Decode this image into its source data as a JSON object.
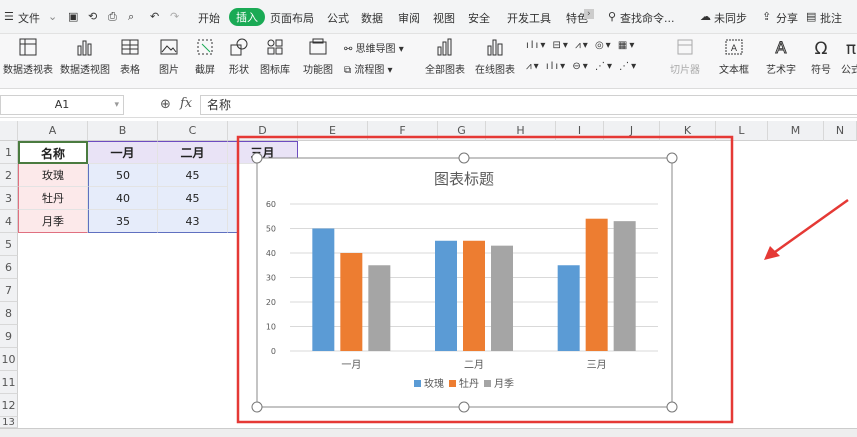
{
  "menubar": {
    "file": "文件",
    "items": [
      "开始",
      "插入",
      "页面布局",
      "公式",
      "数据",
      "审阅",
      "视图",
      "安全",
      "开发工具",
      "特色"
    ],
    "active": "插入",
    "search": "查找命令...",
    "unsync": "未同步",
    "share": "分享",
    "comment": "批注"
  },
  "ribbon": {
    "pivot_table": "数据透视表",
    "pivot_chart": "数据透视图",
    "table": "表格",
    "picture": "图片",
    "screenshot": "截屏",
    "shape": "形状",
    "icon_lib": "图标库",
    "func_chart": "功能图",
    "mindmap": "思维导图",
    "flowchart": "流程图",
    "all_charts": "全部图表",
    "online_chart": "在线图表",
    "slicer": "切片器",
    "textbox": "文本框",
    "wordart": "艺术字",
    "symbol": "符号",
    "formula": "公式"
  },
  "formulabar": {
    "cell_ref": "A1",
    "fx": "fx",
    "content": "名称"
  },
  "columns": [
    "A",
    "B",
    "C",
    "D",
    "E",
    "F",
    "G",
    "H",
    "I",
    "J",
    "K",
    "L",
    "M",
    "N"
  ],
  "rows": [
    "1",
    "2",
    "3",
    "4",
    "5",
    "6",
    "7",
    "8",
    "9",
    "10",
    "11",
    "12",
    "13"
  ],
  "table": {
    "headers": [
      "名称",
      "一月",
      "二月",
      "三月"
    ],
    "rows": [
      [
        "玫瑰",
        "50",
        "45"
      ],
      [
        "牡丹",
        "40",
        "45"
      ],
      [
        "月季",
        "35",
        "43"
      ]
    ]
  },
  "chart_data": {
    "type": "bar",
    "title": "图表标题",
    "categories": [
      "一月",
      "二月",
      "三月"
    ],
    "series": [
      {
        "name": "玫瑰",
        "values": [
          50,
          45,
          35
        ],
        "color": "#5b9bd5"
      },
      {
        "name": "牡丹",
        "values": [
          40,
          45,
          54
        ],
        "color": "#ed7d31"
      },
      {
        "name": "月季",
        "values": [
          35,
          43,
          53
        ],
        "color": "#a5a5a5"
      }
    ],
    "ylim": [
      0,
      60
    ],
    "yticks": [
      "0",
      "10",
      "20",
      "30",
      "40",
      "50",
      "60"
    ],
    "grid": true,
    "legend": "bottom"
  },
  "colors": {
    "accent_green": "#1aaa55",
    "highlight_red": "#e53935"
  }
}
